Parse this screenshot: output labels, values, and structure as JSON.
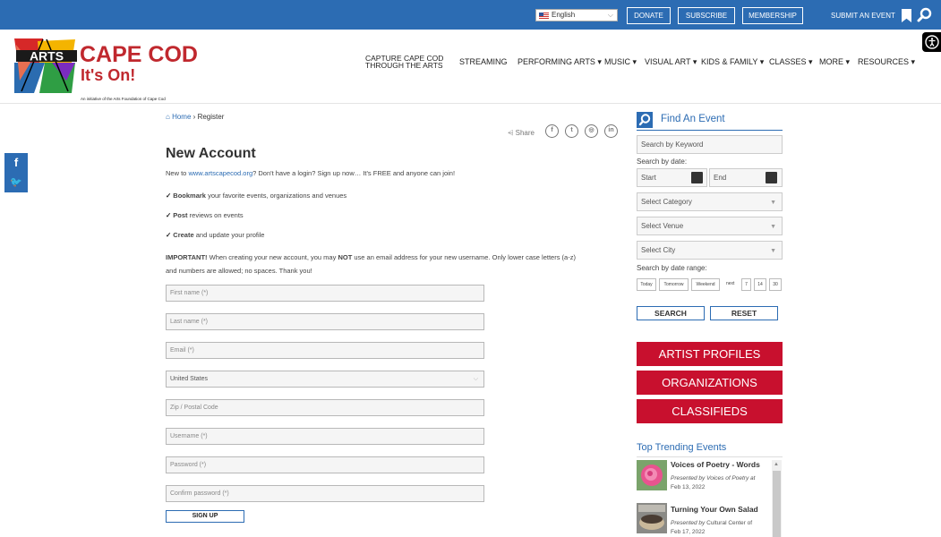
{
  "topbar": {
    "language": "English",
    "buttons": [
      "DONATE",
      "SUBSCRIBE",
      "MEMBERSHIP"
    ],
    "submit_event": "SUBMIT AN EVENT"
  },
  "logo": {
    "text_arts": "ARTS",
    "text_capecod": "CAPE COD",
    "text_itson": "It's On!",
    "tagline": "An initiative of the Arts Foundation of Cape Cod"
  },
  "nav": {
    "capture_line1": "CAPTURE CAPE COD",
    "capture_line2": "THROUGH THE ARTS",
    "items": [
      "STREAMING",
      "PERFORMING ARTS ▾",
      "MUSIC ▾",
      "VISUAL ART ▾",
      "KIDS & FAMILY ▾",
      "CLASSES ▾",
      "MORE ▾",
      "RESOURCES ▾"
    ]
  },
  "breadcrumb": {
    "home": "Home",
    "sep": "›",
    "current": "Register"
  },
  "share": {
    "label": "Share"
  },
  "form": {
    "title": "New Account",
    "intro_pre": "New to ",
    "intro_link": "www.artscapecod.org",
    "intro_post": "? Don't have a login? Sign up now… It's FREE and anyone can join!",
    "benefits": [
      {
        "bold": "Bookmark",
        "rest": " your favorite events, organizations and venues"
      },
      {
        "bold": "Post",
        "rest": " reviews on events"
      },
      {
        "bold": "Create",
        "rest": " and update your profile"
      }
    ],
    "important_bold": "IMPORTANT!",
    "important_1": " When creating your new account, you may ",
    "important_not": "NOT",
    "important_2": " use an email address for your new username. Only lower case letters (a-z)",
    "important_3": "and numbers are allowed; no spaces. Thank you!",
    "fields": {
      "first_name": "First name (*)",
      "last_name": "Last name (*)",
      "email": "Email (*)",
      "country": "United States",
      "zip": "Zip / Postal Code",
      "username": "Username (*)",
      "password": "Password (*)",
      "confirm": "Confirm password (*)"
    },
    "signup": "SIGN UP"
  },
  "find_event": {
    "title": "Find An Event",
    "keyword_placeholder": "Search by Keyword",
    "by_date": "Search by date:",
    "start": "Start",
    "end": "End",
    "category": "Select Category",
    "venue": "Select Venue",
    "city": "Select City",
    "range_label": "Search by date range:",
    "range": [
      "Today",
      "Tomorrow",
      "Weekend"
    ],
    "next": "next",
    "days": [
      "7",
      "14",
      "30"
    ],
    "search": "SEARCH",
    "reset": "RESET"
  },
  "red_buttons": [
    "ARTIST PROFILES",
    "ORGANIZATIONS",
    "CLASSIFIEDS"
  ],
  "trending": {
    "title": "Top Trending Events",
    "events": [
      {
        "title": "Voices of Poetry - Words",
        "by_label": "Presented by",
        "presenter": "Voices of Poetry at",
        "date": "Feb 13, 2022"
      },
      {
        "title": "Turning Your Own Salad",
        "by_label": "Presented by",
        "presenter": "Cultural Center of",
        "date": "Feb 17, 2022"
      }
    ]
  },
  "colors": {
    "brand_blue": "#2c6cb3",
    "red": "#c8102e"
  }
}
